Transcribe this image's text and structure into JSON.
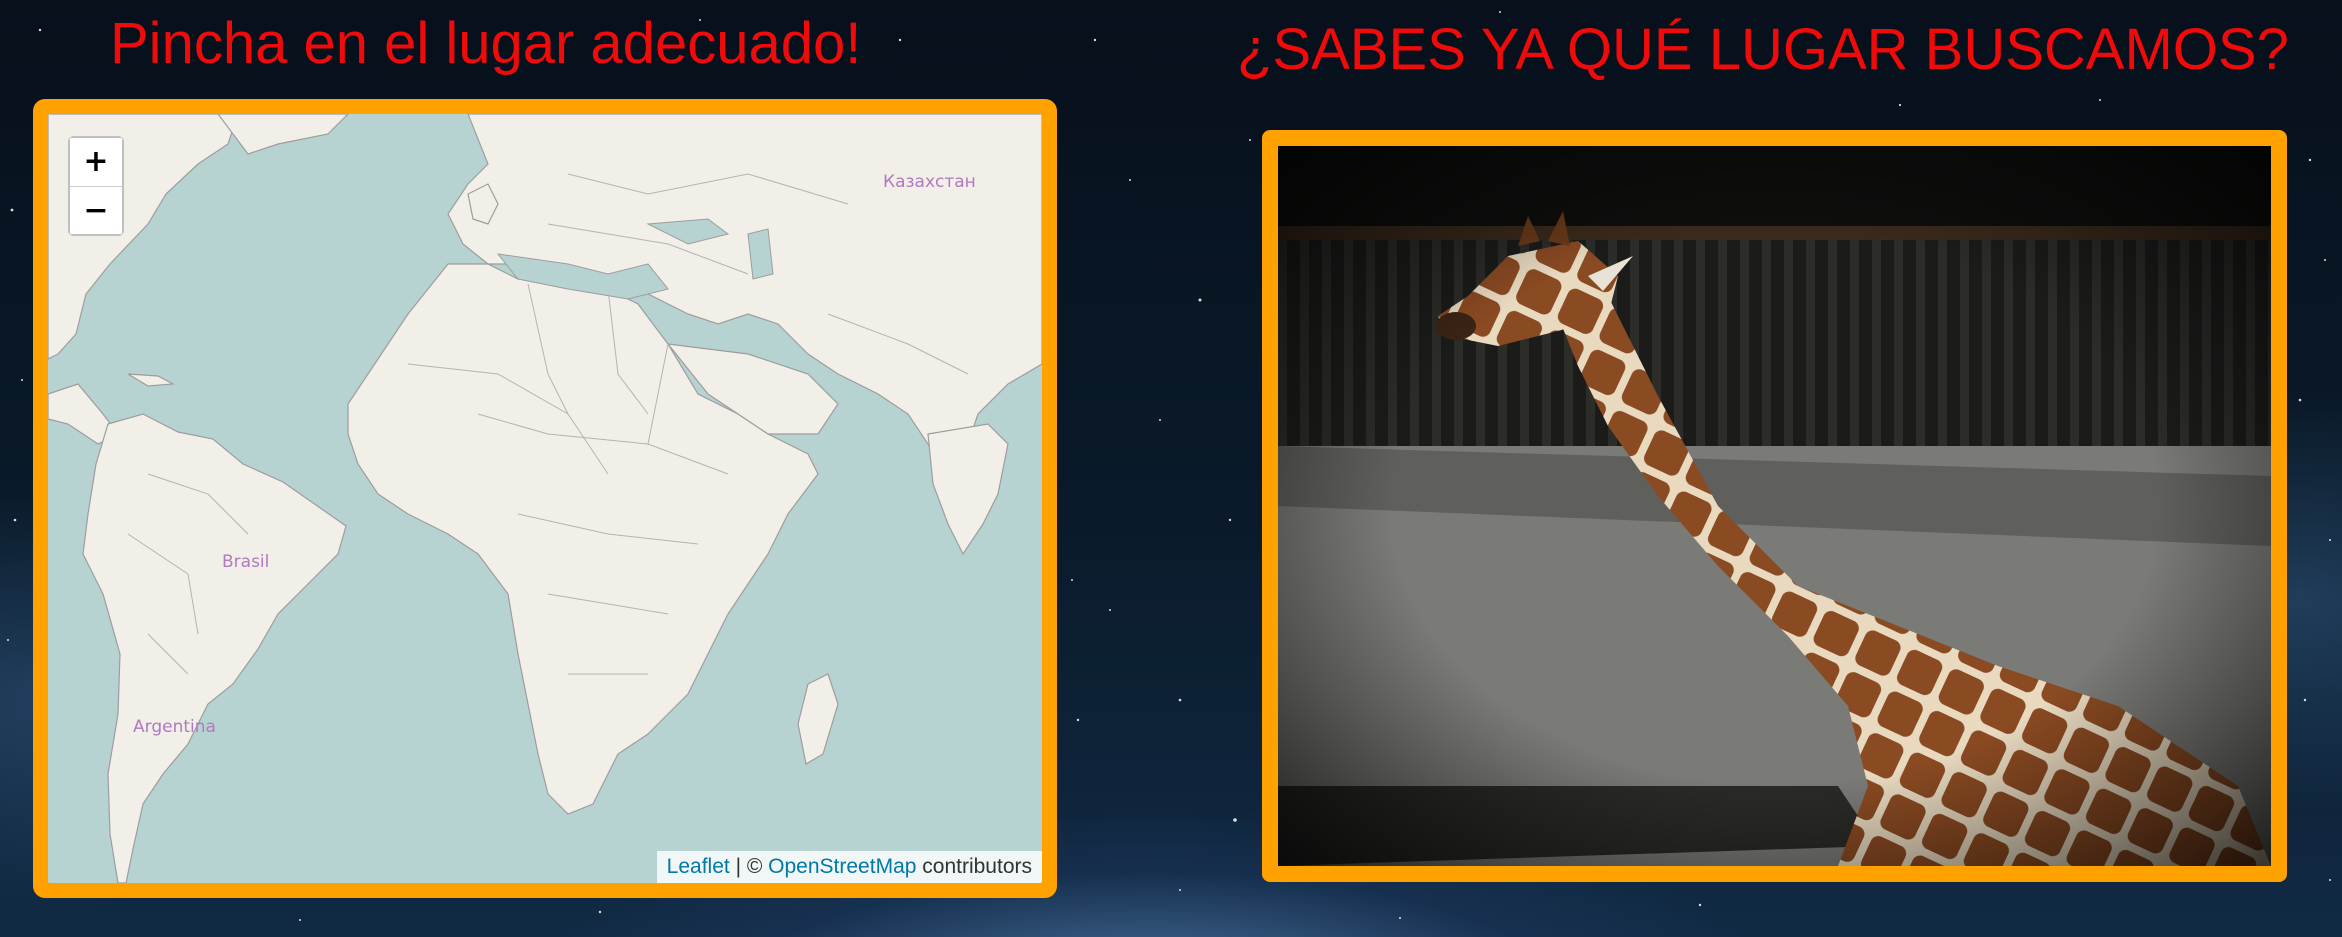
{
  "left_panel": {
    "title": "Pincha en el lugar adecuado!",
    "map": {
      "zoom_in_label": "+",
      "zoom_out_label": "−",
      "labels": {
        "kazakhstan": "Казахстан",
        "brazil": "Brasil",
        "argentina": "Argentina"
      },
      "attribution": {
        "leaflet": "Leaflet",
        "separator": "| ©",
        "osm": "OpenStreetMap",
        "contributors": "contributors"
      }
    }
  },
  "right_panel": {
    "title": "¿SABES YA QUÉ LUGAR BUSCAMOS?",
    "photo_subject": "giraffe"
  },
  "colors": {
    "title": "#f00a0a",
    "frame": "#ffa200",
    "ocean": "#b7d3d1",
    "land": "#f2efe9",
    "link": "#0078a8"
  }
}
